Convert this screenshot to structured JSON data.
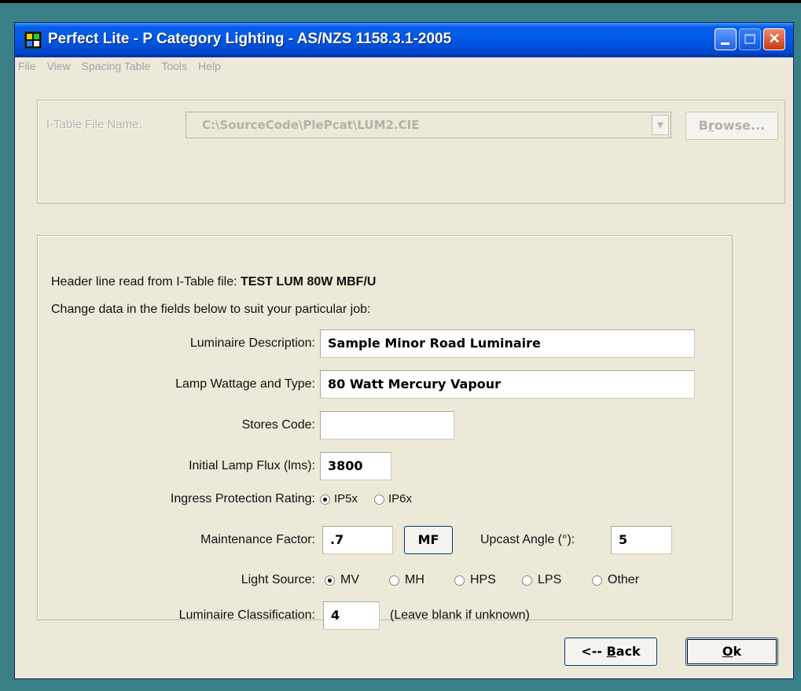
{
  "window": {
    "title": "Perfect Lite - P Category Lighting - AS/NZS 1158.3.1-2005"
  },
  "menu": [
    "File",
    "View",
    "Spacing Table",
    "Tools",
    "Help"
  ],
  "itable": {
    "label": "I-Table File Name:",
    "value": "C:\\SourceCode\\PlePcat\\LUM2.CIE",
    "browse_pre": "B",
    "browse_key": "r",
    "browse_post": "owse..."
  },
  "header": {
    "prefix": "Header line read from I-Table file:",
    "value": "TEST LUM 80W MBF/U",
    "instruction": "Change data in the fields below to suit your particular job:"
  },
  "fields": {
    "luminaire_description": {
      "label": "Luminaire Description:",
      "value": "Sample Minor Road Luminaire"
    },
    "lamp_wattage": {
      "label": "Lamp Wattage and Type:",
      "value": "80 Watt Mercury Vapour"
    },
    "stores_code": {
      "label": "Stores Code:",
      "value": ""
    },
    "lamp_flux": {
      "label": "Initial Lamp Flux (lms):",
      "value": "3800"
    },
    "ingress": {
      "label": "Ingress Protection Rating:",
      "options": [
        "IP5x",
        "IP6x"
      ],
      "selected": "IP5x"
    },
    "maintenance": {
      "label": "Maintenance Factor:",
      "value": ".7",
      "mf_button": "MF"
    },
    "upcast": {
      "label": "Upcast Angle (°):",
      "value": "5"
    },
    "light_source": {
      "label": "Light Source:",
      "options": [
        "MV",
        "MH",
        "HPS",
        "LPS",
        "Other"
      ],
      "selected": "MV"
    },
    "classification": {
      "label": "Luminaire Classification:",
      "value": "4",
      "hint": "(Leave blank if unknown)"
    }
  },
  "buttons": {
    "back_pre": "<-- ",
    "back_key": "B",
    "back_post": "ack",
    "ok_key": "O",
    "ok_post": "k"
  }
}
